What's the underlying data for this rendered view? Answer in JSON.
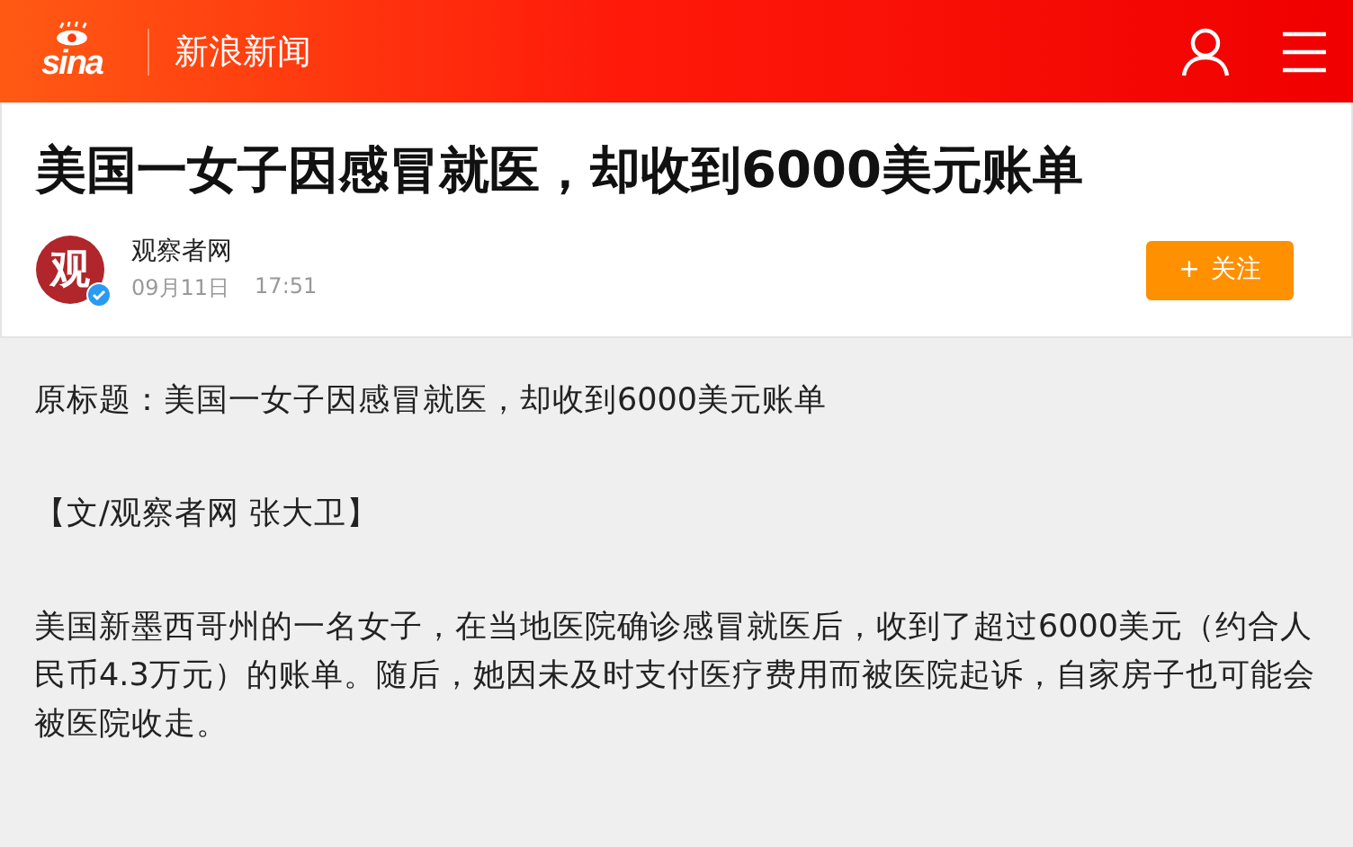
{
  "header": {
    "logo": "sina",
    "title": "新浪新闻"
  },
  "article": {
    "headline": "美国一女子因感冒就医，却收到6000美元账单",
    "author": {
      "avatar_text": "观",
      "name": "观察者网",
      "verified": true,
      "date": "09月11日",
      "time": "17:51"
    },
    "follow_button": {
      "icon": "+",
      "label": "关注"
    }
  },
  "paragraphs": [
    "原标题：美国一女子因感冒就医，却收到6000美元账单",
    "【文/观察者网 张大卫】",
    "美国新墨西哥州的一名女子，在当地医院确诊感冒就医后，收到了超过6000美元（约合人民币4.3万元）的账单。随后，她因未及时支付医疗费用而被医院起诉，自家房子也可能会被医院收走。"
  ]
}
